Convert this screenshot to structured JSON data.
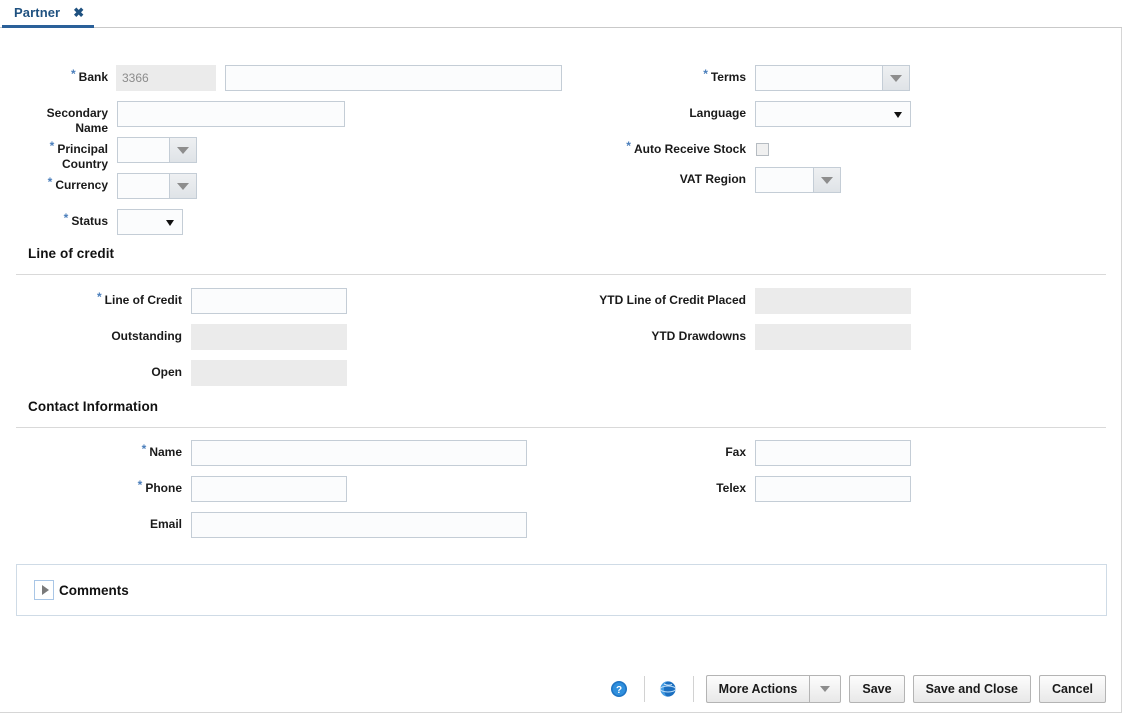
{
  "tab": {
    "label": "Partner",
    "close_icon": "close-icon",
    "close_glyph": "✖"
  },
  "bank_section": {
    "fields": {
      "bank": {
        "label": "Bank",
        "required": true,
        "id_value": "3366",
        "name_value": "",
        "id_readonly": true
      },
      "secondary_name": {
        "label": "Secondary\nName",
        "required": false,
        "value": ""
      },
      "principal_country": {
        "label": "Principal\nCountry",
        "required": true,
        "value": ""
      },
      "currency": {
        "label": "Currency",
        "required": true,
        "value": ""
      },
      "status": {
        "label": "Status",
        "required": true,
        "value": ""
      },
      "terms": {
        "label": "Terms",
        "required": true,
        "value": ""
      },
      "language": {
        "label": "Language",
        "required": false,
        "value": ""
      },
      "auto_receive_stock": {
        "label": "Auto Receive Stock",
        "required": true,
        "checked": false
      },
      "vat_region": {
        "label": "VAT Region",
        "required": false,
        "value": ""
      }
    }
  },
  "line_of_credit": {
    "title": "Line of credit",
    "fields": {
      "line_of_credit": {
        "label": "Line of Credit",
        "required": true,
        "value": "",
        "readonly": false
      },
      "outstanding": {
        "label": "Outstanding",
        "required": false,
        "value": "",
        "readonly": true
      },
      "open": {
        "label": "Open",
        "required": false,
        "value": "",
        "readonly": true
      },
      "ytd_line_of_credit_placed": {
        "label": "YTD Line of Credit Placed",
        "required": false,
        "value": "",
        "readonly": true
      },
      "ytd_drawdowns": {
        "label": "YTD Drawdowns",
        "required": false,
        "value": "",
        "readonly": true
      }
    }
  },
  "contact_information": {
    "title": "Contact Information",
    "fields": {
      "name": {
        "label": "Name",
        "required": true,
        "value": ""
      },
      "phone": {
        "label": "Phone",
        "required": true,
        "value": ""
      },
      "email": {
        "label": "Email",
        "required": false,
        "value": ""
      },
      "fax": {
        "label": "Fax",
        "required": false,
        "value": ""
      },
      "telex": {
        "label": "Telex",
        "required": false,
        "value": ""
      }
    }
  },
  "comments": {
    "label": "Comments",
    "expanded": false,
    "disclosure_icon": "triangle-right-icon"
  },
  "footer": {
    "help_icon": "help-icon",
    "translate_icon": "globe-icon",
    "more_actions_label": "More Actions",
    "more_actions_caret_icon": "chevron-down-icon",
    "save_label": "Save",
    "save_and_close_label": "Save and Close",
    "cancel_label": "Cancel"
  },
  "colors": {
    "accent": "#2a6099",
    "tab_text": "#1f5180",
    "required_asterisk": "#4a7ebb",
    "readonly_bg": "#ebebeb",
    "input_border": "#c4cdd6",
    "panel_border": "#cfdbe6"
  }
}
